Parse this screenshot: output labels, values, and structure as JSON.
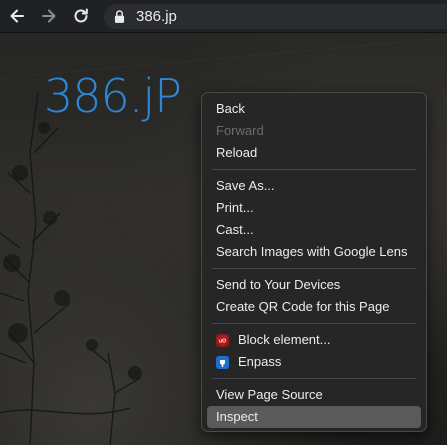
{
  "browser": {
    "url": "386.jp",
    "icons": {
      "back": "back-arrow-icon",
      "forward": "forward-arrow-icon",
      "reload": "reload-icon",
      "lock": "lock-icon"
    }
  },
  "page": {
    "logo_text": "386.jP",
    "logo_color": "#2e86d6"
  },
  "context_menu": {
    "back": "Back",
    "forward": "Forward",
    "reload": "Reload",
    "save_as": "Save As...",
    "print": "Print...",
    "cast": "Cast...",
    "search_images": "Search Images with Google Lens",
    "send_to_devices": "Send to Your Devices",
    "create_qr": "Create QR Code for this Page",
    "block_element": "Block element...",
    "enpass": "Enpass",
    "view_source": "View Page Source",
    "inspect": "Inspect"
  }
}
